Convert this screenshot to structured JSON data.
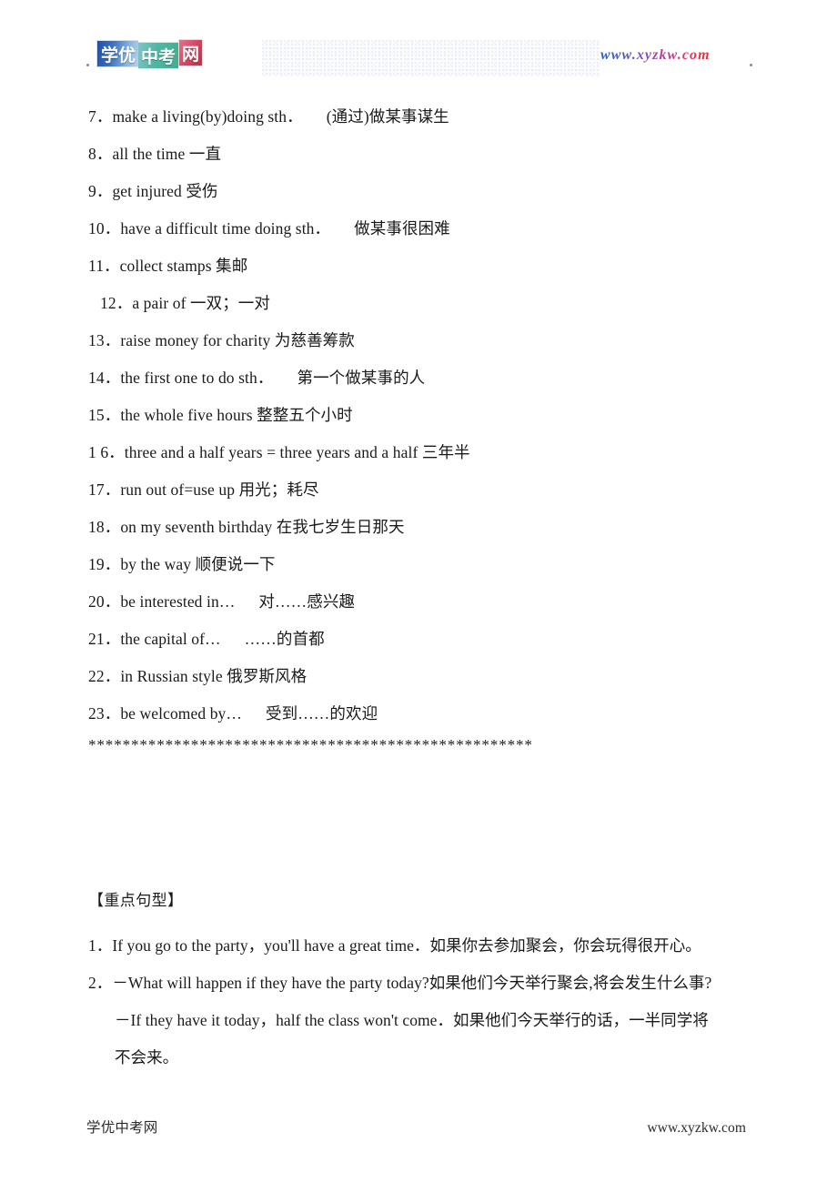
{
  "header": {
    "logo_segments": [
      {
        "text": "学优",
        "color": "#2f63b5"
      },
      {
        "text": "中考",
        "color": "#45b39a"
      },
      {
        "text": "网",
        "color": "#c83a52"
      }
    ],
    "logo_alt": "学优中考网",
    "url": "www.xyzkw.com",
    "url_gradient_start": "#2f5fc0",
    "url_gradient_end": "#e0332f"
  },
  "phrases": [
    {
      "num": "7．",
      "text": "make a living(by)doing sth．",
      "gloss": "(通过)做某事谋生",
      "indented": false,
      "wide_gap": true
    },
    {
      "num": "8．",
      "text": "all the time 一直",
      "gloss": "",
      "indented": false,
      "wide_gap": false
    },
    {
      "num": "9．",
      "text": "get injured 受伤",
      "gloss": "",
      "indented": false,
      "wide_gap": false
    },
    {
      "num": "10．",
      "text": "have a difficult time doing sth．",
      "gloss": "做某事很困难",
      "indented": false,
      "wide_gap": true
    },
    {
      "num": "11．",
      "text": "collect stamps 集邮",
      "gloss": "",
      "indented": false,
      "wide_gap": false
    },
    {
      "num": "12．",
      "text": "a pair of 一双；一对",
      "gloss": "",
      "indented": true,
      "wide_gap": false
    },
    {
      "num": "13．",
      "text": "raise money for charity 为慈善筹款",
      "gloss": "",
      "indented": false,
      "wide_gap": false
    },
    {
      "num": "14．",
      "text": "the first one to do sth．",
      "gloss": "第一个做某事的人",
      "indented": false,
      "wide_gap": true
    },
    {
      "num": "15．",
      "text": "the whole five hours 整整五个小时",
      "gloss": "",
      "indented": false,
      "wide_gap": false
    },
    {
      "num": "1 6．",
      "text": "three and a half years = three years and a half 三年半",
      "gloss": "",
      "indented": false,
      "wide_gap": false
    },
    {
      "num": "17．",
      "text": "run out of=use up 用光；耗尽",
      "gloss": "",
      "indented": false,
      "wide_gap": false
    },
    {
      "num": "18．",
      "text": "on my seventh birthday 在我七岁生日那天",
      "gloss": "",
      "indented": false,
      "wide_gap": false
    },
    {
      "num": "19．",
      "text": "by the way 顺便说一下",
      "gloss": "",
      "indented": false,
      "wide_gap": false
    },
    {
      "num": "20．",
      "text": "be interested in…",
      "gloss": "对……感兴趣",
      "indented": false,
      "wide_gap": true
    },
    {
      "num": "21．",
      "text": "the capital of…",
      "gloss": "……的首都",
      "indented": false,
      "wide_gap": true
    },
    {
      "num": "22．",
      "text": "in Russian style 俄罗斯风格",
      "gloss": "",
      "indented": false,
      "wide_gap": false
    },
    {
      "num": "23．",
      "text": "be welcomed by…",
      "gloss": "受到……的欢迎",
      "indented": false,
      "wide_gap": true
    }
  ],
  "divider": "****************************************************",
  "patterns_section": {
    "heading": "【重点句型】",
    "lines": [
      {
        "text": "1．If you go to the party，you'll have a great time．如果你去参加聚会，你会玩得很开心。",
        "hang": false
      },
      {
        "text": "2．－What will happen if they have the party today?如果他们今天举行聚会,将会发生什么事?",
        "hang": false
      },
      {
        "text": "－If they have it today，half the class won't come．如果他们今天举行的话，一半同学将",
        "hang": true
      },
      {
        "text": "不会来。",
        "hang": true
      }
    ]
  },
  "footer": {
    "left": "学优中考网",
    "right": "www.xyzkw.com"
  }
}
